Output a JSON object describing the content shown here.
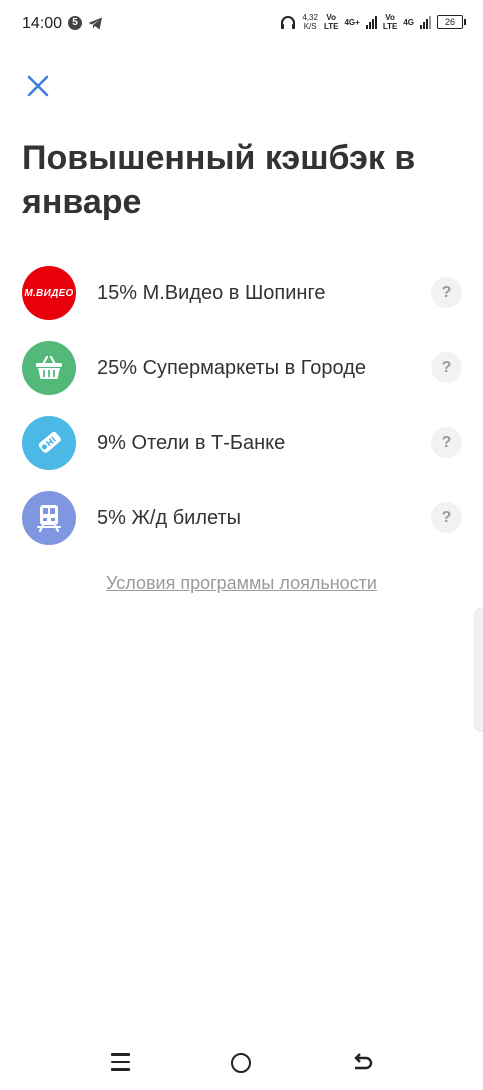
{
  "status_bar": {
    "time": "14:00",
    "notification_count": "5",
    "net_speed_value": "4,32",
    "net_speed_unit": "K/S",
    "sim1_label_top": "Vo",
    "sim1_label_bottom": "LTE",
    "sim1_network": "4G+",
    "sim2_label_top": "Vo",
    "sim2_label_bottom": "LTE",
    "sim2_network": "4G",
    "battery_level": "26"
  },
  "header": {
    "title": "Повышенный кэшбэк в январе"
  },
  "offers": [
    {
      "label": "15% М.Видео в Шопинге",
      "icon": "mvideo-logo",
      "color": "#e8000b",
      "brand_text": "М.ВИДЕО"
    },
    {
      "label": "25% Супермаркеты в Городе",
      "icon": "basket-icon",
      "color": "#52b978"
    },
    {
      "label": "9% Отели в Т-Банке",
      "icon": "hotel-tag-icon",
      "color": "#4cb8e6"
    },
    {
      "label": "5% Ж/д билеты",
      "icon": "train-icon",
      "color": "#7f96e0"
    }
  ],
  "help_symbol": "?",
  "loyalty_link": "Условия программы лояльности"
}
